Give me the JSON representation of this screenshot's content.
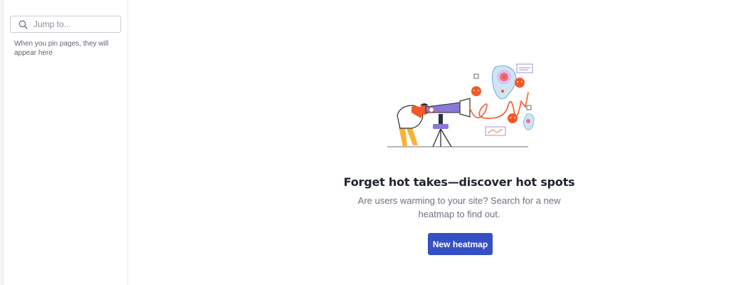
{
  "sidebar": {
    "search": {
      "placeholder": "Jump to...",
      "value": ""
    },
    "pin_hint": "When you pin pages, they will appear here"
  },
  "empty_state": {
    "headline": "Forget hot takes—discover hot spots",
    "subtext_line1": "Are users warming to your site? Search for a new",
    "subtext_line2": "heatmap to find out.",
    "cta_label": "New heatmap"
  },
  "colors": {
    "accent": "#3450c4",
    "illustration_orange": "#f15a24",
    "illustration_purple": "#8b78d6",
    "illustration_yellow": "#f9b233"
  },
  "icons": {
    "search": "search-icon",
    "illustration": "telescope-heatmap-illustration"
  }
}
